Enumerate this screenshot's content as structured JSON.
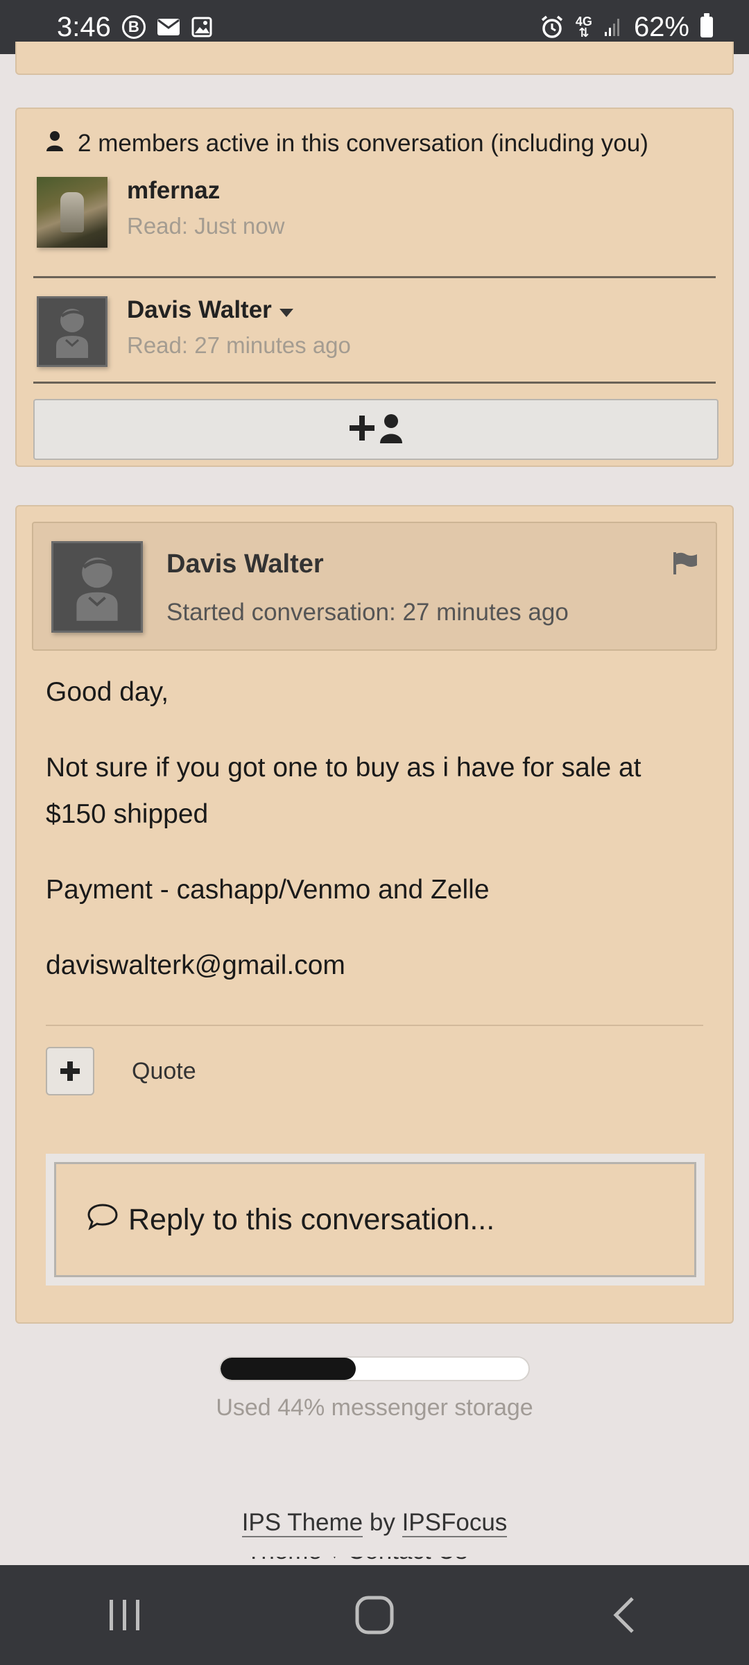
{
  "status_bar": {
    "time": "3:46",
    "battery": "62%",
    "left_icons": [
      "b-badge-icon",
      "mail-icon",
      "image-icon"
    ],
    "right_icons": [
      "alarm-icon",
      "4g-data-icon",
      "signal-icon",
      "battery-icon"
    ]
  },
  "members": {
    "header": "2 members active in this conversation (including you)",
    "items": [
      {
        "name": "mfernaz",
        "read": "Read: Just now",
        "has_dropdown": false
      },
      {
        "name": "Davis Walter",
        "read": "Read: 27 minutes ago",
        "has_dropdown": true
      }
    ],
    "add_button_icon": "add-user-icon"
  },
  "post": {
    "author": "Davis Walter",
    "started": "Started conversation: 27 minutes ago",
    "paragraphs": [
      "Good day,",
      "Not sure if you got one to buy as i have for sale at $150 shipped",
      "Payment - cashapp/Venmo and Zelle",
      "daviswalterk@gmail.com"
    ],
    "quote_label": "Quote",
    "reply_placeholder": "Reply to this conversation..."
  },
  "storage": {
    "percent_used": 44,
    "text": "Used 44% messenger storage"
  },
  "footer": {
    "theme_link": "IPS Theme",
    "by": "by",
    "author_link": "IPSFocus",
    "cut_text": "Theme ▾   Contact Us"
  },
  "colors": {
    "card_bg": "#ecd3b4",
    "page_bg": "#e8e3e2",
    "system_bar": "#36373b"
  }
}
